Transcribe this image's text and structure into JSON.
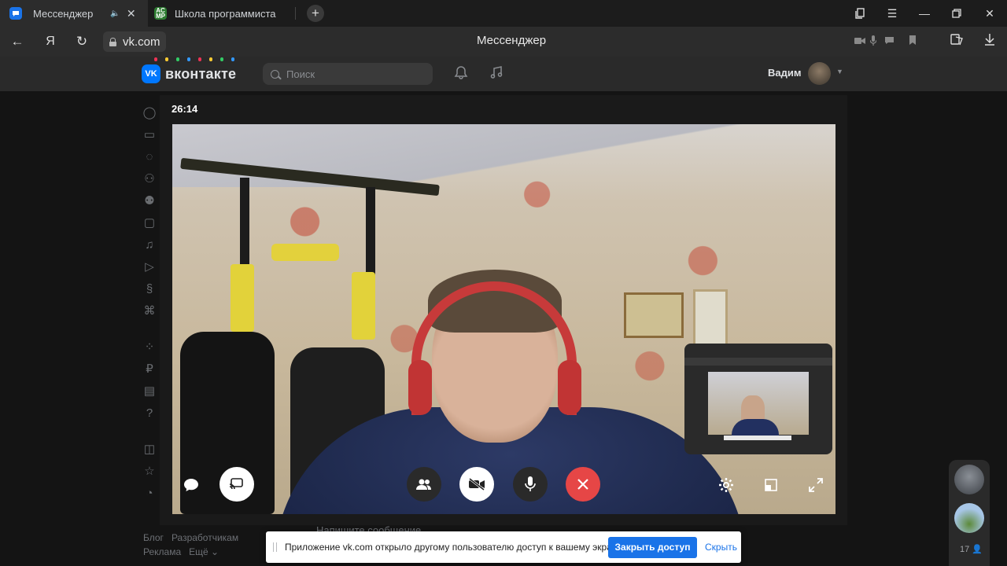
{
  "browser": {
    "tabs": [
      {
        "title": "Мессенджер",
        "active": true,
        "favicon": "chat-bubble-icon",
        "favicon_color": "#1a73e8"
      },
      {
        "title": "Школа программиста",
        "active": false,
        "favicon": "acmp-icon",
        "favicon_text": "AC MP",
        "favicon_color": "#2e7d32"
      }
    ],
    "address": "vk.com",
    "page_title": "Мессенджер",
    "nav_back": "←",
    "nav_home": "Я",
    "nav_reload": "↻"
  },
  "vk": {
    "logo_text": "вконтакте",
    "logo_badge": "VK",
    "search_placeholder": "Поиск",
    "user_name": "Вадим",
    "footer_links": [
      "Блог",
      "Разработчикам",
      "Реклама",
      "Ещё ⌄"
    ],
    "message_placeholder": "Напишите сообщение...",
    "mini_chat_count": "17"
  },
  "call": {
    "timer": "26:14",
    "controls": [
      "chat-icon",
      "screen-share-icon",
      "participants-icon",
      "camera-off-icon",
      "microphone-icon",
      "end-call-icon",
      "settings-icon",
      "minimize-window-icon",
      "fullscreen-icon"
    ]
  },
  "share_notice": {
    "message": "Приложение vk.com открыло другому пользователю доступ к вашему экрану",
    "stop_button": "Закрыть доступ",
    "hide_button": "Скрыть"
  },
  "colors": {
    "accent_blue": "#1a73e8",
    "vk_blue": "#0077ff",
    "end_call_red": "#e64646"
  }
}
